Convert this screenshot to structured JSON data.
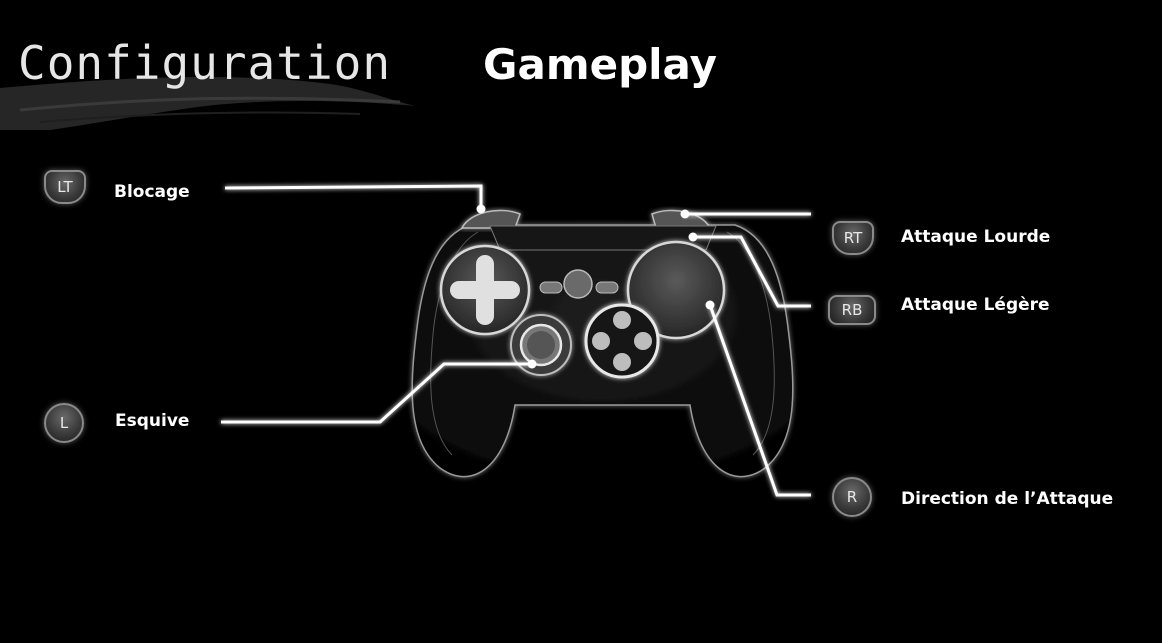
{
  "header": {
    "title": "Configuration",
    "subtitle": "Gameplay"
  },
  "controls": {
    "lt": {
      "button": "LT",
      "action": "Blocage",
      "icon": "lt-trigger-icon"
    },
    "rt": {
      "button": "RT",
      "action": "Attaque Lourde",
      "icon": "rt-trigger-icon"
    },
    "rb": {
      "button": "RB",
      "action": "Attaque Légère",
      "icon": "rb-bumper-icon"
    },
    "l": {
      "button": "L",
      "action": "Esquive",
      "icon": "left-stick-icon"
    },
    "r": {
      "button": "R",
      "action": "Direction de l’Attaque",
      "icon": "right-stick-icon"
    }
  },
  "colors": {
    "background": "#000000",
    "text": "#ffffff",
    "lines": "#ffffff"
  }
}
